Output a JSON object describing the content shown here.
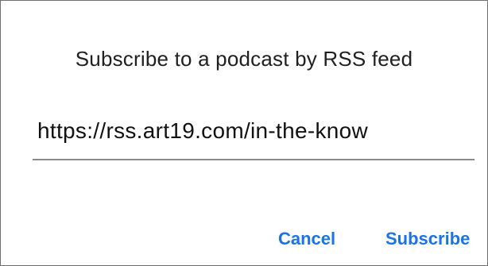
{
  "dialog": {
    "title": "Subscribe to a podcast by RSS feed",
    "feed_url": {
      "value": "https://rss.art19.com/in-the-know"
    },
    "actions": {
      "cancel_label": "Cancel",
      "subscribe_label": "Subscribe"
    },
    "accent_color": "#1a73e8"
  }
}
